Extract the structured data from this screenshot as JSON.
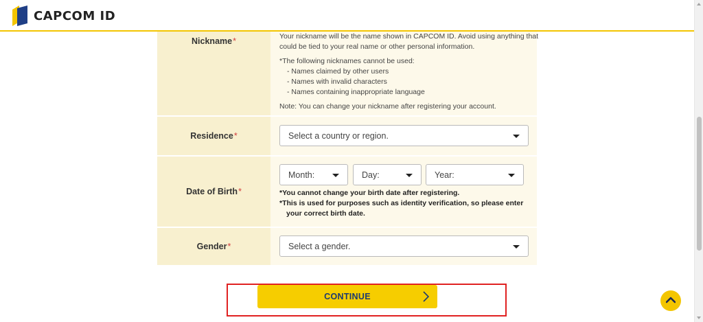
{
  "header": {
    "brand": "CAPCOM ID",
    "logo_icon": "capcom-logo-icon",
    "accent_color": "#f3c500"
  },
  "form": {
    "nickname": {
      "label": "Nickname",
      "required_mark": "*",
      "description": [
        "Your nickname will be the name shown in CAPCOM ID. Avoid using anything that",
        "could be tied to your real name or other personal information."
      ],
      "rules_intro": "*The following nicknames cannot be used:",
      "rules": [
        "- Names claimed by other users",
        "- Names with invalid characters",
        "- Names containing inappropriate language"
      ],
      "note": "Note: You can change your nickname after registering your account."
    },
    "residence": {
      "label": "Residence",
      "required_mark": "*",
      "placeholder": "Select a country or region."
    },
    "dob": {
      "label": "Date of Birth",
      "required_mark": "*",
      "month": "Month:",
      "day": "Day:",
      "year": "Year:",
      "note1": "*You cannot change your birth date after registering.",
      "note2a": "*This is used for purposes such as identity verification, so please enter",
      "note2b": "your correct birth date."
    },
    "gender": {
      "label": "Gender",
      "required_mark": "*",
      "placeholder": "Select a gender."
    }
  },
  "continue_button": {
    "label": "CONTINUE",
    "color": "#f6cd00",
    "highlight_color": "#e02020"
  },
  "scroll_top_icon": "chevron-up-icon"
}
